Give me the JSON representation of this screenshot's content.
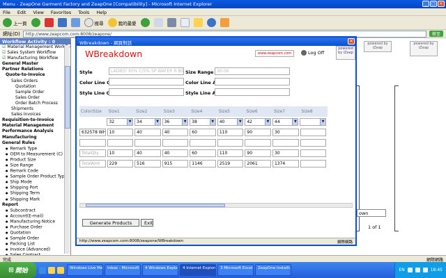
{
  "ie": {
    "title": "Menu - ZeapOne Garment Factory and ZeapOne [Compatibility] - Microsoft Internet Explorer",
    "menu": [
      "File",
      "Edit",
      "View",
      "Favorites",
      "Tools",
      "Help"
    ],
    "toolbar": {
      "back": "上一頁",
      "search": "搜尋",
      "favorites": "我的最愛"
    },
    "address_label": "網址(D)",
    "address": "http://www.zeapcom.com:8008/zeapone/",
    "go": "移至",
    "status_left": "完成",
    "status_right": "網際網路"
  },
  "workflow": {
    "header": "Workflow Activity : 0",
    "items": [
      {
        "label": "Material Management Workflow",
        "cls": "chk"
      },
      {
        "label": "Sales System Workflow",
        "cls": "chk"
      },
      {
        "label": "Manufacturing Workflow",
        "cls": "chk"
      },
      {
        "label": "General Master",
        "cls": "section"
      },
      {
        "label": "Partner Relations",
        "cls": "section"
      },
      {
        "label": "Quote-to-Invoice",
        "cls": "section l1"
      },
      {
        "label": "Sales Orders",
        "cls": "l2"
      },
      {
        "label": "Quotation",
        "cls": "l3"
      },
      {
        "label": "Sample Order",
        "cls": "l3"
      },
      {
        "label": "Sales Order",
        "cls": "l3"
      },
      {
        "label": "Order Batch Process",
        "cls": "l3"
      },
      {
        "label": "Shipments",
        "cls": "l2"
      },
      {
        "label": "Sales Invoices",
        "cls": "l2"
      },
      {
        "label": "Requisition-to-Invoice",
        "cls": "section"
      },
      {
        "label": "Material Management",
        "cls": "section"
      },
      {
        "label": "Performance Analysis",
        "cls": "section"
      },
      {
        "label": "Manufacturing",
        "cls": "section"
      },
      {
        "label": "General Rules",
        "cls": "section"
      },
      {
        "label": "Remark Type",
        "cls": "l1 dot"
      },
      {
        "label": "OEM to Measurement (C)",
        "cls": "l1 dot"
      },
      {
        "label": "Product Size",
        "cls": "l1 dot"
      },
      {
        "label": "Size Range",
        "cls": "l1 dot"
      },
      {
        "label": "Remark Code",
        "cls": "l1 dot"
      },
      {
        "label": "Sample Order Product Type",
        "cls": "l1 dot"
      },
      {
        "label": "Ship Mode",
        "cls": "l1 dot"
      },
      {
        "label": "Shipping Port",
        "cls": "l1 dot"
      },
      {
        "label": "Shipping Term",
        "cls": "l1 dot"
      },
      {
        "label": "Shipping Mark",
        "cls": "l1 dot"
      },
      {
        "label": "Report",
        "cls": "section"
      },
      {
        "label": "Subcontract",
        "cls": "l1 dot"
      },
      {
        "label": "Account(E-mail)",
        "cls": "l1 dot"
      },
      {
        "label": "Manufacturing Notice",
        "cls": "l1 dot"
      },
      {
        "label": "Purchase Order",
        "cls": "l1 dot"
      },
      {
        "label": "Quotation",
        "cls": "l1 dot"
      },
      {
        "label": "Sample Order",
        "cls": "l1 dot"
      },
      {
        "label": "Packing List",
        "cls": "l1 dot"
      },
      {
        "label": "Invoice (Advanced)",
        "cls": "l1 dot"
      },
      {
        "label": "Sales Contract",
        "cls": "l1 dot"
      }
    ]
  },
  "background": {
    "logo1": "powered by iZeap",
    "logo2": "powered by iZeap",
    "down_label": "own",
    "pager": "1 of 1"
  },
  "popup": {
    "title": "WBreakdown - 網頁對話",
    "app_title": "WBreakdown",
    "zeap_logo": "www.zeapcom.com",
    "logoff": "Log Off",
    "logo_r": "powered by iZeap",
    "form": {
      "style_label": "Style",
      "style_value": "LADIES' 95% C/5% SP WAFER R BS",
      "size_range_label": "Size Range",
      "size_range_value": "30-56",
      "color_line_qty_label": "Color Line Qty",
      "color_line_amt_label": "Color Line Amt",
      "style_line_qty_label": "Style Line Qty",
      "style_line_amt_label": "Style Line Amt"
    },
    "grid": {
      "headers": [
        "Color/Size",
        "Size1",
        "Size2",
        "Size3",
        "Size4",
        "Size5",
        "Size6",
        "Size7",
        "Size8"
      ],
      "sizes": [
        "32",
        "34",
        "36",
        "38",
        "40",
        "42",
        "44"
      ],
      "row_color": "632578 WH",
      "row_values": [
        "10",
        "40",
        "40",
        "60",
        "110",
        "90",
        "30"
      ],
      "total_qty_label": "TotalQty",
      "total_qty": [
        "10",
        "40",
        "40",
        "60",
        "110",
        "90",
        "30"
      ],
      "total_amt_label": "TotalAmt",
      "total_amt": [
        "229",
        "516",
        "915",
        "1146",
        "2519",
        "2061",
        "1374"
      ]
    },
    "generate_btn": "Generate Products",
    "exit_btn": "Exit",
    "status_url": "http://www.zeapcom.com:8008/zeapone/WBreakdown",
    "status_zone": "網際網路"
  },
  "taskbar": {
    "start": "開始",
    "tasks": [
      "Windows Live Messenger",
      "Inbox - Microsoft Outl...",
      "4 Windows Explorer",
      "4 Internet Explorer",
      "3 Microsoft Excel fo...",
      "ZeapOne Installt..."
    ],
    "lang": "EN",
    "time": "18:45"
  }
}
